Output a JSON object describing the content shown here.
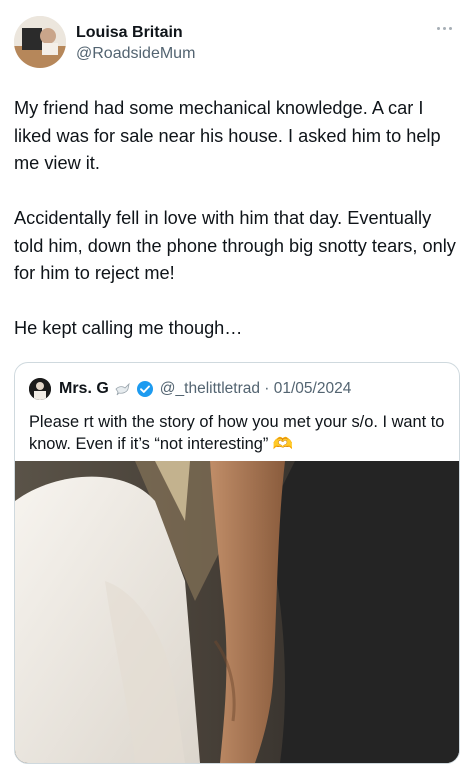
{
  "author": {
    "name": "Louisa Britain",
    "handle": "@RoadsideMum"
  },
  "tweet": {
    "text": "My friend had some mechanical knowledge. A car I liked was for sale near his house. I asked him to help me view it.\n\nAccidentally fell in love with him that day. Eventually told him, down the phone through big snotty tears, only for him to reject me!\n\nHe kept calling me though…"
  },
  "quoted": {
    "name": "Mrs. G",
    "meta": "@_thelittletrad · 01/05/2024",
    "text": "Please rt with the story of how you met your s/o. I want to know. Even if it’s “not interesting” 🫶",
    "icons": [
      "dove-icon",
      "verified-badge-icon",
      "heart-hands-emoji"
    ]
  },
  "colors": {
    "text": "#0f1419",
    "secondary": "#536471",
    "border": "#cfd9de",
    "verified": "#1d9bf0"
  }
}
